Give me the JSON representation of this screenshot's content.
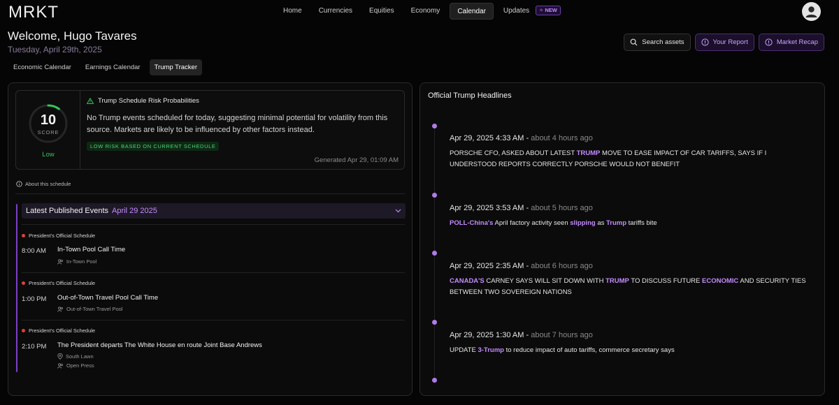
{
  "app": {
    "logo": "MRKT"
  },
  "nav": {
    "items": [
      {
        "label": "Home"
      },
      {
        "label": "Currencies"
      },
      {
        "label": "Equities"
      },
      {
        "label": "Economy"
      },
      {
        "label": "Calendar",
        "active": true
      },
      {
        "label": "Updates",
        "badge": "NEW"
      }
    ]
  },
  "header": {
    "welcome": "Welcome, Hugo Tavares",
    "date": "Tuesday, April 29th, 2025"
  },
  "tabs": [
    {
      "label": "Economic Calendar"
    },
    {
      "label": "Earnings Calendar"
    },
    {
      "label": "Trump Tracker",
      "active": true
    }
  ],
  "actions": {
    "search": "Search assets",
    "report": "Your Report",
    "recap": "Market Recap"
  },
  "risk": {
    "score": "10",
    "score_label": "SCORE",
    "level": "Low",
    "score_fraction": 0.1,
    "title": "Trump Schedule Risk Probabilities",
    "description": "No Trump events scheduled for today, suggesting minimal potential for volatility from this source. Markets are likely to be influenced by other factors instead.",
    "badge": "LOW RISK BASED ON CURRENT SCHEDULE",
    "generated": "Generated Apr 29, 01:09 AM"
  },
  "about": "About this schedule",
  "events": {
    "title": "Latest Published Events",
    "date": "April 29 2025",
    "items": [
      {
        "tag": "President's Official Schedule",
        "time": "8:00 AM",
        "title": "In-Town Pool Call Time",
        "meta": [
          "In-Town Pool"
        ]
      },
      {
        "tag": "President's Official Schedule",
        "time": "1:00 PM",
        "title": "Out-of-Town Travel Pool Call Time",
        "meta": [
          "Out-of-Town Travel Pool"
        ]
      },
      {
        "tag": "President's Official Schedule",
        "time": "2:10 PM",
        "title": "The President departs The White House en route Joint Base Andrews",
        "meta": [
          "South Lawn",
          "Open Press"
        ]
      }
    ]
  },
  "headlines": {
    "title": "Official Trump Headlines",
    "items": [
      {
        "time": "Apr 29, 2025 4:33 AM",
        "ago": "about 4 hours ago",
        "parts": [
          {
            "t": "PORSCHE CFO, ASKED ABOUT LATEST "
          },
          {
            "t": "TRUMP",
            "hi": true
          },
          {
            "t": " MOVE TO EASE IMPACT OF CAR TARIFFS, SAYS IF I UNDERSTOOD REPORTS CORRECTLY PORSCHE WOULD NOT BENEFIT"
          }
        ]
      },
      {
        "time": "Apr 29, 2025 3:53 AM",
        "ago": "about 5 hours ago",
        "parts": [
          {
            "t": "POLL-China's",
            "hi": true
          },
          {
            "t": " April factory activity seen "
          },
          {
            "t": "slipping",
            "hi": true
          },
          {
            "t": " as "
          },
          {
            "t": "Trump",
            "hi": true
          },
          {
            "t": " tariffs bite"
          }
        ]
      },
      {
        "time": "Apr 29, 2025 2:35 AM",
        "ago": "about 6 hours ago",
        "parts": [
          {
            "t": "CANADA'S",
            "hi": true
          },
          {
            "t": " CARNEY SAYS WILL SIT DOWN WITH "
          },
          {
            "t": "TRUMP",
            "hi": true
          },
          {
            "t": " TO DISCUSS FUTURE "
          },
          {
            "t": "ECONOMIC",
            "hi": true
          },
          {
            "t": " AND SECURITY TIES BETWEEN TWO SOVEREIGN NATIONS"
          }
        ]
      },
      {
        "time": "Apr 29, 2025 1:30 AM",
        "ago": "about 7 hours ago",
        "parts": [
          {
            "t": "UPDATE "
          },
          {
            "t": "3-Trump",
            "hi": true
          },
          {
            "t": " to reduce impact of auto tariffs, commerce secretary says"
          }
        ]
      }
    ]
  },
  "colors": {
    "accent": "#c48bff",
    "risk_low": "#34c759",
    "event_dot": "#e0413a"
  }
}
